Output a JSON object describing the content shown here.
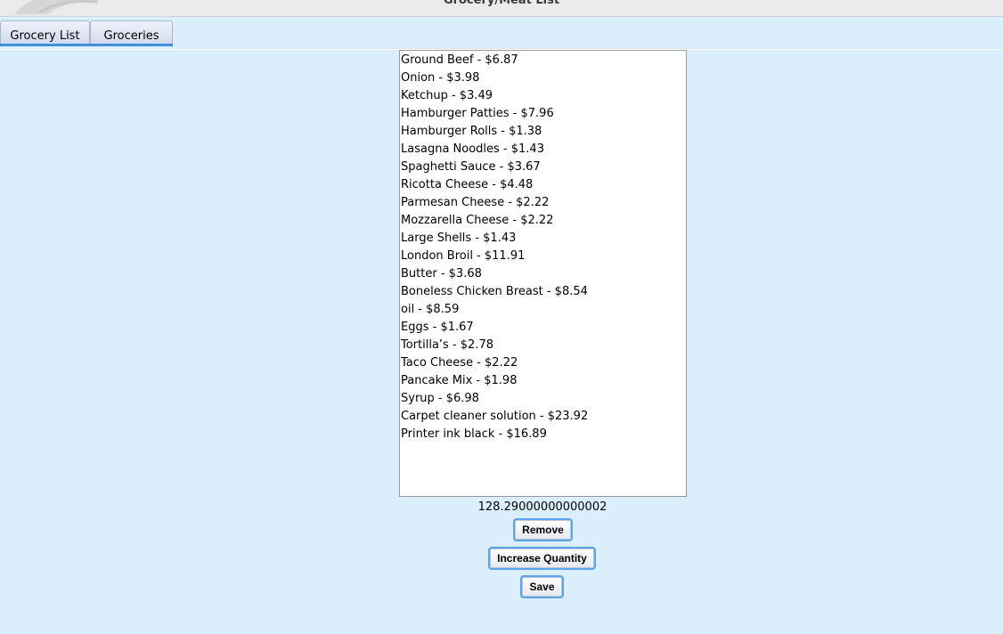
{
  "window": {
    "title": "Grocery/Meat List"
  },
  "tabs": [
    {
      "label": "Grocery List"
    },
    {
      "label": "Groceries"
    }
  ],
  "list": {
    "items": [
      "Ground Beef - $6.87",
      "Onion - $3.98",
      "Ketchup - $3.49",
      "Hamburger Patties - $7.96",
      "Hamburger Rolls - $1.38",
      "Lasagna Noodles - $1.43",
      "Spaghetti Sauce - $3.67",
      "Ricotta Cheese - $4.48",
      "Parmesan Cheese - $2.22",
      "Mozzarella Cheese - $2.22",
      "Large Shells - $1.43",
      "London Broil - $11.91",
      "Butter - $3.68",
      "Boneless Chicken Breast - $8.54",
      "oil - $8.59",
      "Eggs - $1.67",
      "Tortilla’s - $2.78",
      "Taco Cheese - $2.22",
      "Pancake Mix - $1.98",
      "Syrup - $6.98",
      "Carpet cleaner solution - $23.92",
      "Printer ink black - $16.89"
    ]
  },
  "total": "128.29000000000002",
  "buttons": {
    "remove": "Remove",
    "increase": "Increase Quantity",
    "save": "Save"
  },
  "colors": {
    "background": "#daeefb",
    "accent": "#3e8fd8"
  }
}
